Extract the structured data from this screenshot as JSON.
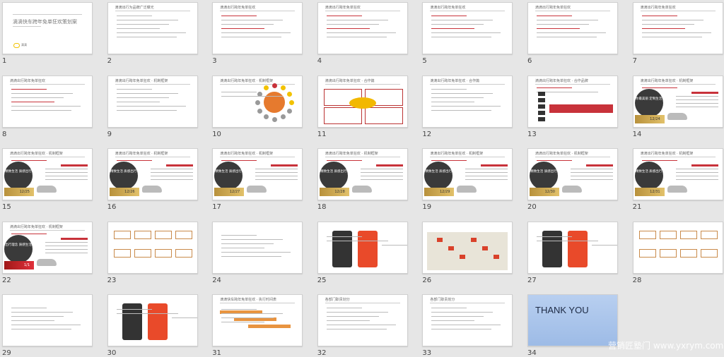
{
  "view": "slide-sorter",
  "slides": [
    {
      "number": "1",
      "type": "cover",
      "title": "滴滴快车跨年免单狂欢策划案",
      "logo_text": "滴滴"
    },
    {
      "number": "2",
      "type": "text",
      "title": "滴滴出行为品牌广泛曝光"
    },
    {
      "number": "3",
      "type": "text",
      "title": "滴滴出行跨年免单狂欢"
    },
    {
      "number": "4",
      "type": "text",
      "title": "滴滴出行跨年免单狂欢"
    },
    {
      "number": "5",
      "type": "text",
      "title": "滴滴出行跨年免单狂欢"
    },
    {
      "number": "6",
      "type": "text",
      "title": "滴滴出行跨年免单狂欢"
    },
    {
      "number": "7",
      "type": "text",
      "title": "滴滴出行跨年免单狂欢"
    },
    {
      "number": "8",
      "type": "text",
      "title": "滴滴出行跨年免单狂欢"
    },
    {
      "number": "9",
      "type": "text",
      "title": "滴滴出行跨年免单狂欢 · 机制框架"
    },
    {
      "number": "10",
      "type": "wheel",
      "title": "滴滴出行跨年免单狂欢 · 机制框架"
    },
    {
      "number": "11",
      "type": "boxes",
      "title": "滴滴出行跨年免单狂欢 · 合作篇"
    },
    {
      "number": "12",
      "type": "text",
      "title": "滴滴出行跨年免单狂欢 · 合作篇"
    },
    {
      "number": "13",
      "type": "brands",
      "title": "滴滴出行跨年免单狂欢 · 合作品牌"
    },
    {
      "number": "14",
      "type": "day",
      "title": "滴滴出行跨年免单狂欢 · 机制框架",
      "circle": "你最美丽 定制生活",
      "date": "12/24"
    },
    {
      "number": "15",
      "type": "day",
      "title": "滴滴出行跨年免单狂欢 · 机制框架",
      "circle": "精致生活 质感出行",
      "date": "12/25"
    },
    {
      "number": "16",
      "type": "day",
      "title": "滴滴出行跨年免单狂欢 · 机制框架",
      "circle": "精致生活 质感出行",
      "date": "12/26"
    },
    {
      "number": "17",
      "type": "day",
      "title": "滴滴出行跨年免单狂欢 · 机制框架",
      "circle": "精致生活 质感出行",
      "date": "12/27"
    },
    {
      "number": "18",
      "type": "day",
      "title": "滴滴出行跨年免单狂欢 · 机制框架",
      "circle": "精致生活 质感出行",
      "date": "12/28"
    },
    {
      "number": "19",
      "type": "day",
      "title": "滴滴出行跨年免单狂欢 · 机制框架",
      "circle": "精致生活 质感出行",
      "date": "12/29"
    },
    {
      "number": "20",
      "type": "day",
      "title": "滴滴出行跨年免单狂欢 · 机制框架",
      "circle": "精致生活 质感出行",
      "date": "12/30"
    },
    {
      "number": "21",
      "type": "day",
      "title": "滴滴出行跨年免单狂欢 · 机制框架",
      "circle": "精致生活 质感出行",
      "date": "12/31"
    },
    {
      "number": "22",
      "type": "day-red",
      "title": "滴滴出行跨年免单狂欢 · 机制框架",
      "circle": "出行理念 质感生活",
      "date": "1/1"
    },
    {
      "number": "23",
      "type": "flow",
      "title": ""
    },
    {
      "number": "24",
      "type": "text",
      "title": ""
    },
    {
      "number": "25",
      "type": "app",
      "title": ""
    },
    {
      "number": "26",
      "type": "map",
      "title": ""
    },
    {
      "number": "27",
      "type": "app",
      "title": ""
    },
    {
      "number": "28",
      "type": "flow",
      "title": ""
    },
    {
      "number": "29",
      "type": "text",
      "title": ""
    },
    {
      "number": "30",
      "type": "app",
      "title": ""
    },
    {
      "number": "31",
      "type": "timeline",
      "title": "滴滴快车跨年免单狂欢 · 执行时间表"
    },
    {
      "number": "32",
      "type": "text",
      "title": "各部门职责划分"
    },
    {
      "number": "33",
      "type": "text",
      "title": "各部门职责划分"
    },
    {
      "number": "34",
      "type": "thanks",
      "title": "THANK YOU"
    }
  ],
  "watermark": "营销匠塾门 www.yxrym.com",
  "colors": {
    "background": "#e6e6e6",
    "accent_red": "#c8323a",
    "gold": "#d4b05a",
    "thanks_blue": "#a9c5ec"
  }
}
